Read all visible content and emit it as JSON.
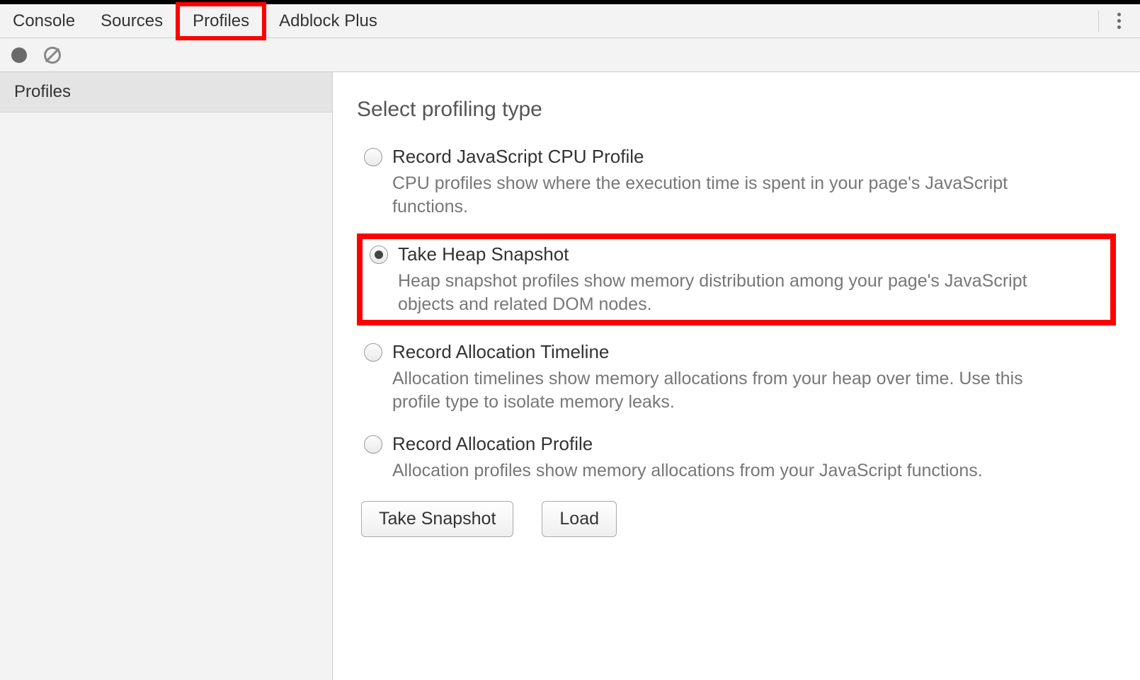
{
  "tabs": {
    "console": "Console",
    "sources": "Sources",
    "profiles": "Profiles",
    "adblock": "Adblock Plus"
  },
  "sidebar": {
    "profiles_label": "Profiles"
  },
  "content": {
    "title": "Select profiling type",
    "options": [
      {
        "title": "Record JavaScript CPU Profile",
        "desc": "CPU profiles show where the execution time is spent in your page's JavaScript functions."
      },
      {
        "title": "Take Heap Snapshot",
        "desc": "Heap snapshot profiles show memory distribution among your page's JavaScript objects and related DOM nodes."
      },
      {
        "title": "Record Allocation Timeline",
        "desc": "Allocation timelines show memory allocations from your heap over time. Use this profile type to isolate memory leaks."
      },
      {
        "title": "Record Allocation Profile",
        "desc": "Allocation profiles show memory allocations from your JavaScript functions."
      }
    ],
    "buttons": {
      "primary": "Take Snapshot",
      "load": "Load"
    }
  }
}
